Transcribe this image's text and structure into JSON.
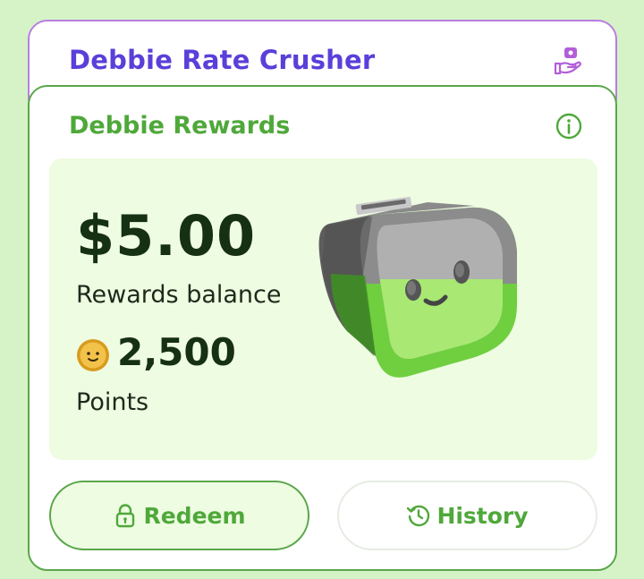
{
  "back_card": {
    "title": "Debbie Rate Crusher",
    "icon": "hand-with-coin-icon"
  },
  "rewards_card": {
    "title": "Debbie Rewards",
    "info_icon": "info-icon",
    "balance": {
      "value": "$5.00",
      "label": "Rewards balance"
    },
    "points": {
      "value": "2,500",
      "label": "Points",
      "icon": "coin-face-icon"
    },
    "mascot": "piggy-bank-mascot"
  },
  "actions": {
    "redeem_label": "Redeem",
    "redeem_icon": "lock-icon",
    "history_label": "History",
    "history_icon": "history-icon"
  },
  "colors": {
    "background": "#d6f3c8",
    "accent_purple": "#5b3fd9",
    "accent_green": "#4fa83a",
    "panel_green": "#eefce2"
  }
}
